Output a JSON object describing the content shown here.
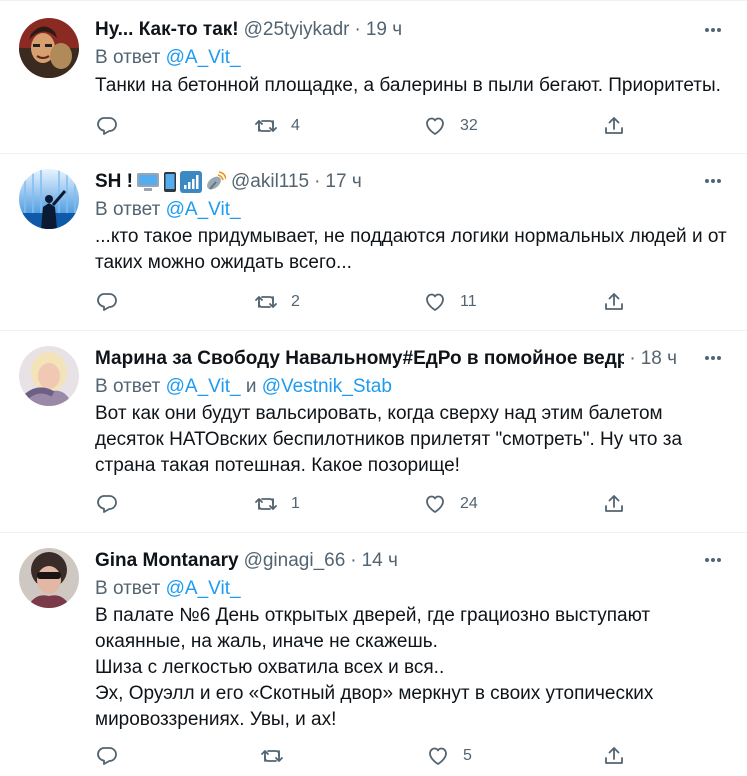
{
  "tweets": [
    {
      "name": "Ну... Как-то так!",
      "handle": "@25tyiykadr",
      "time": "19 ч",
      "reply_prefix": "В ответ ",
      "reply_to": "@A_Vit_",
      "reply_join": "",
      "reply_to2": "",
      "text": "Танки на бетонной площадке, а балерины в пыли бегают. Приоритеты.",
      "replies": "",
      "retweets": "4",
      "likes": "32",
      "avatar_color": "#8a2a22"
    },
    {
      "name": "SH !",
      "handle": "@akil115",
      "time": "17 ч",
      "reply_prefix": "В ответ ",
      "reply_to": "@A_Vit_",
      "reply_join": "",
      "reply_to2": "",
      "text": "...кто такое придумывает, не поддаются логики нормальных людей и от таких можно ожидать всего...",
      "replies": "",
      "retweets": "2",
      "likes": "11",
      "avatar_color": "#1f7fd6"
    },
    {
      "name": "Марина за Свободу Навальному#ЕдРо в помойное ведро",
      "handle": "",
      "time": "18 ч",
      "reply_prefix": "В ответ ",
      "reply_to": "@A_Vit_",
      "reply_join": " и ",
      "reply_to2": "@Vestnik_Stab",
      "text": "Вот как они будут вальсировать, когда сверху над этим балетом десяток НАТОвских беспилотников прилетят \"смотреть\". Ну что за страна такая потешная. Какое позорище!",
      "replies": "",
      "retweets": "1",
      "likes": "24",
      "avatar_color": "#c9b9c4"
    },
    {
      "name": "Gina Montanary",
      "handle": "@ginagi_66",
      "time": "14 ч",
      "reply_prefix": "В ответ ",
      "reply_to": "@A_Vit_",
      "reply_join": "",
      "reply_to2": "",
      "text": "В палате №6 День открытых дверей, где грациозно выступают окаянные, на жаль,  иначе не скажешь.\nШиза с легкостью охватила всех и вся..\nЭх, Оруэлл и его «Скотный двор» меркнут в своих утопических мировоззрениях. Увы, и ах!",
      "replies": "",
      "retweets": "",
      "likes": "5",
      "avatar_color": "#7a6a66"
    }
  ],
  "icons": {
    "reply": "reply-icon",
    "retweet": "retweet-icon",
    "like": "heart-icon",
    "share": "share-icon",
    "more": "more-icon"
  }
}
